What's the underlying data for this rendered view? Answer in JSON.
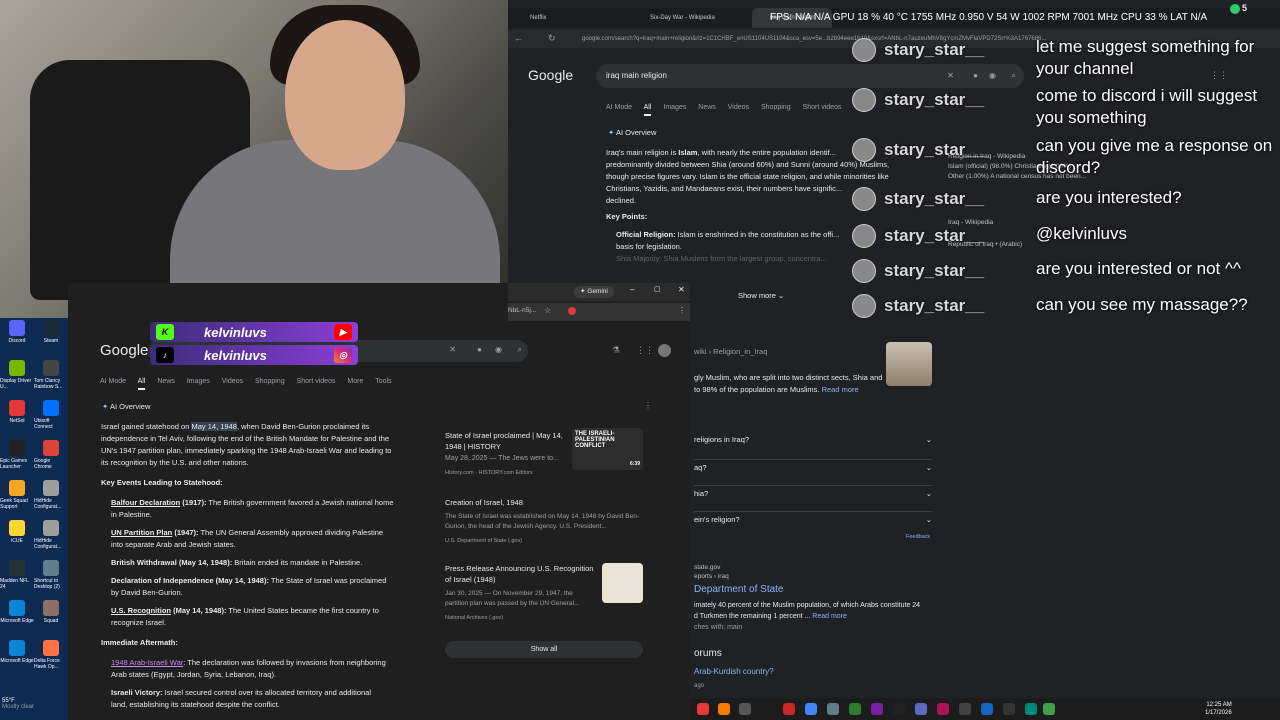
{
  "right_browser": {
    "tabs": [
      "Netflix",
      "Six-Day War - Wikipedia",
      "iraq main religion"
    ],
    "url": "google.com/search?q=iraq+main+religion&rlz=1C1CHBF_enUS1104US1104&sca_esv=5e...b2b94eee1b10&sxsrf=ANbL-n7auzeuMhV8gYcmZMvFlaVPD72Srr%3A1767686...",
    "logo": "Google",
    "query": "iraq main religion",
    "filters": [
      "AI Mode",
      "All",
      "Images",
      "News",
      "Videos",
      "Shopping",
      "Short videos"
    ],
    "ai_overview": "AI Overview",
    "intro_a": "Iraq's main religion is ",
    "intro_b": "Islam",
    "intro_c": ", with nearly the entire population identif...",
    "line2": "predominantly divided between Shia (around 60%) and Sunni (around 40%) Muslims,",
    "line3": "though precise figures vary. Islam is the official state religion, and while minorities like",
    "line4": "Christians, Yazidis, and Mandaeans exist, their numbers have signific...",
    "line5": "declined.",
    "key_points": "Key Points:",
    "kp1_label": "Official Religion:",
    "kp1_text": " Islam is enshrined in the constitution as the offi...",
    "kp1_cont": "basis for legislation.",
    "kp2": "Shia Majority: Shia Muslims form the largest group, concentra...",
    "show_more": "Show more",
    "wiki_crumb": "wiki › Religion_in_Iraq",
    "wiki_snippet": "gly Muslim, who are split into two distinct sects, Shia and",
    "wiki_snippet2": "to 98% of the population are Muslims.",
    "read_more": "Read more",
    "paa": [
      "religions in Iraq?",
      "aq?",
      "hia?",
      "ein's religion?"
    ],
    "feedback": "Feedback",
    "state_url": "state.gov",
    "state_crumb": "eports › iraq",
    "state_title": "Department of State",
    "state_snip1": "imately 40 percent of the Muslim population, of which Arabs constitute 24",
    "state_snip2": "d Turkmen the remaining 1 percent ...",
    "state_mentions": "ches with: main",
    "forums": "orums",
    "forum_q": "Arab-Kurdish country?",
    "forum_date": "ago",
    "kp_side1": "Religion in Iraq - Wikipedia",
    "kp_side2": "Islam (official) (98.0%) Christianity (1.00%)",
    "kp_side3": "Other (1.00%) A national census has not been...",
    "kp_side4": "Iraq - Wikipedia",
    "kp_side5": "Republic of Iraq • (Arabic)"
  },
  "left_browser": {
    "gemini": "Gemini",
    "url_frag": "NbL-n5j...",
    "logo": "Google",
    "filters": [
      "AI Mode",
      "All",
      "News",
      "Images",
      "Videos",
      "Shopping",
      "Short videos",
      "More",
      "Tools"
    ],
    "ai_overview": "AI Overview",
    "p1_a": "Israel gained statehood on ",
    "p1_date": "May 14, 1948",
    "p1_b": ", when David Ben-Gurion proclaimed its",
    "p1_l2": "independence in Tel Aviv, following the end of the British Mandate for Palestine and the",
    "p1_l3": "UN's 1947 partition plan, immediately sparking the 1948 Arab-Israeli War and leading to",
    "p1_l4": "its recognition by the U.S. and other nations.",
    "key_events": "Key Events Leading to Statehood:",
    "events": [
      {
        "title": "Balfour Declaration",
        "suffix": " (1917):",
        "text": " The British government favored a Jewish national home",
        "cont": "in Palestine."
      },
      {
        "title": "UN Partition Plan",
        "suffix": " (1947):",
        "text": " The UN General Assembly approved dividing Palestine",
        "cont": "into separate Arab and Jewish states."
      },
      {
        "title": "British Withdrawal (May 14, 1948):",
        "suffix": "",
        "text": " Britain ended its mandate in Palestine.",
        "cont": ""
      },
      {
        "title": "Declaration of Independence (May 14, 1948):",
        "suffix": "",
        "text": " The State of Israel was proclaimed",
        "cont": "by David Ben-Gurion."
      },
      {
        "title": "U.S. Recognition",
        "suffix": " (May 14, 1948):",
        "text": " The United States became the first country to",
        "cont": "recognize Israel."
      }
    ],
    "aftermath": "Immediate Aftermath:",
    "after1_title": "1948 Arab-Israeli War",
    "after1_text": ": The declaration was followed by invasions from neighboring",
    "after1_cont": "Arab states (Egypt, Jordan, Syria, Lebanon, Iraq).",
    "after2_title": "Israeli Victory:",
    "after2_text": " Israel secured control over its allocated territory and additional",
    "after2_cont": "land, establishing its statehood despite the conflict.",
    "cards": [
      {
        "title": "State of Israel proclaimed | May 14, 1948 | HISTORY",
        "date": "May 28, 2025 — The Jews were to...",
        "source": "History.com · HISTORY.com Editors"
      },
      {
        "title": "Creation of Israel, 1948",
        "date": "The State of Israel was established on May 14, 1948 by David Ben-Gurion, the head of the Jewish Agency. U.S. President...",
        "source": "U.S. Department of State (.gov)"
      },
      {
        "title": "Press Release Announcing U.S. Recognition of Israel (1948)",
        "date": "Jan 30, 2025 — On November 29, 1947, the partition plan was passed by the UN General...",
        "source": "National Archives (.gov)"
      }
    ],
    "thumb_caption": "THE ISRAELI-PALESTINIAN CONFLICT",
    "thumb_time": "6:39",
    "show_all": "Show all"
  },
  "socials": {
    "name1": "kelvinluvs",
    "name2": "kelvinluvs"
  },
  "hud": "FPS: N/A N/A   GPU 18 % 40 °C 1755 MHz 0.950 V 54 W 1002 RPM 7001 MHz   CPU 33 %   LAT N/A",
  "chat": [
    {
      "user": "stary_star__",
      "msg": "let me suggest something for your channel"
    },
    {
      "user": "stary_star__",
      "msg": "come to discord i will suggest you something"
    },
    {
      "user": "stary_star__",
      "msg": "can you give me a response on discord?"
    },
    {
      "user": "stary_star__",
      "msg": "are you interested?"
    },
    {
      "user": "stary_star__",
      "msg": "@kelvinluvs"
    },
    {
      "user": "stary_star__",
      "msg": "are you interested or not ^^"
    },
    {
      "user": "stary_star__",
      "msg": "can you see my massage??"
    }
  ],
  "desktop_icons": [
    "Discord",
    "Steam",
    "Display Driver U...",
    "Tom Clancy Rainbow S...",
    "NetSol",
    "Ubisoft Connect",
    "Epic Games Launcher",
    "Google Chrome",
    "Geek Squad Support",
    "HidHide Configurat...",
    "iCUE",
    "HidHide Configurat...",
    "Madden NFL 24",
    "Shortcut to Desktop (2)",
    "Microsoft Edge",
    "Squad",
    "Microsoft Edge",
    "Delta Force Hawk Op..."
  ],
  "weather": {
    "temp": "55°F",
    "cond": "Mostly clear"
  },
  "clock": {
    "time": "12:25 AM",
    "date": "1/17/2026"
  },
  "tray_count": "5"
}
